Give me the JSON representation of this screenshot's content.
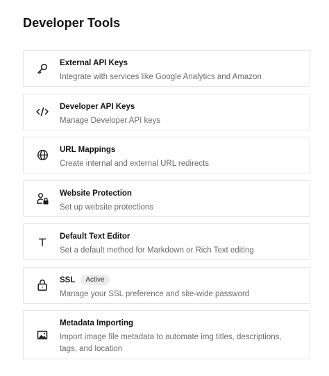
{
  "page": {
    "title": "Developer Tools"
  },
  "items": [
    {
      "title": "External API Keys",
      "description": "Integrate with services like Google Analytics and Amazon",
      "icon": "key-icon"
    },
    {
      "title": "Developer API Keys",
      "description": "Manage Developer API keys",
      "icon": "code-icon"
    },
    {
      "title": "URL Mappings",
      "description": "Create internal and external URL redirects",
      "icon": "globe-icon"
    },
    {
      "title": "Website Protection",
      "description": "Set up website protections",
      "icon": "user-lock-icon"
    },
    {
      "title": "Default Text Editor",
      "description": "Set a default method for Markdown or Rich Text editing",
      "icon": "text-icon"
    },
    {
      "title": "SSL",
      "badge": "Active",
      "description": "Manage your SSL preference and site-wide password",
      "icon": "lock-icon"
    },
    {
      "title": "Metadata Importing",
      "description": "Import image file metadata to automate img titles, descriptions, tags, and location",
      "icon": "image-icon"
    }
  ]
}
